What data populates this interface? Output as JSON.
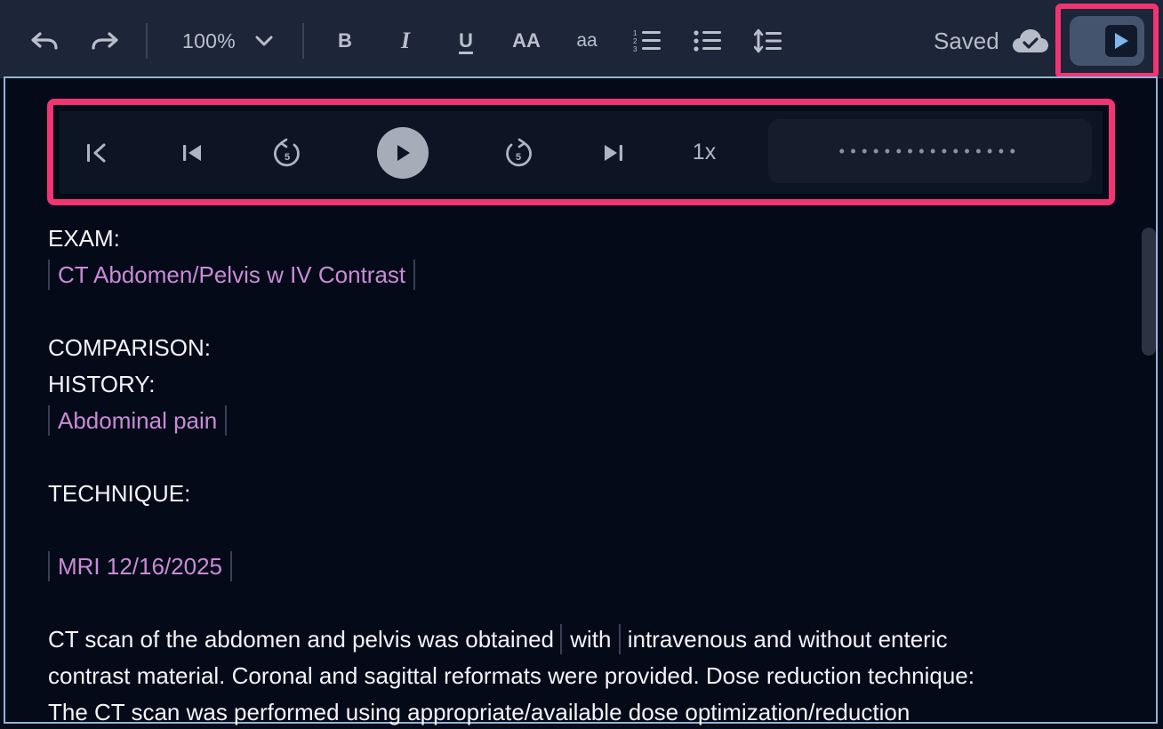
{
  "toolbar": {
    "undo_icon": "undo-icon",
    "redo_icon": "redo-icon",
    "zoom": "100%",
    "bold_label": "B",
    "italic_label": "I",
    "underline_label": "U",
    "uppercase_label": "AA",
    "lowercase_label": "aa",
    "numbered_list_icon": "numbered-list-icon",
    "bulleted_list_icon": "bulleted-list-icon",
    "line_spacing_icon": "line-spacing-icon",
    "status": "Saved",
    "status_icon": "cloud-check-icon",
    "dictation_toggle_icon": "play-icon"
  },
  "player": {
    "skip_to_start_icon": "skip-to-start-icon",
    "previous_icon": "previous-track-icon",
    "rewind_icon": "rewind-5-icon",
    "play_icon": "play-icon",
    "forward_icon": "forward-5-icon",
    "next_icon": "next-track-icon",
    "speed": "1x",
    "waveform": "••••••••••••••••"
  },
  "document": {
    "exam_label": "EXAM:",
    "exam_value": "CT Abdomen/Pelvis w IV Contrast",
    "comparison_label": "COMPARISON:",
    "history_label": "HISTORY:",
    "history_value": "Abdominal pain",
    "technique_label": "TECHNIQUE:",
    "technique_value": "MRI 12/16/2025",
    "body_line1_before": "CT scan of the abdomen and pelvis was obtained",
    "body_line1_field": "with",
    "body_line1_after": "intravenous and without enteric",
    "body_line2": "contrast material. Coronal and sagittal reformats were provided. Dose reduction technique:",
    "body_line3": "The CT scan was performed using appropriate/available dose optimization/reduction"
  },
  "colors": {
    "highlight": "#f23572",
    "field_text": "#c98bd6",
    "editor_border": "#8fb4d9"
  }
}
